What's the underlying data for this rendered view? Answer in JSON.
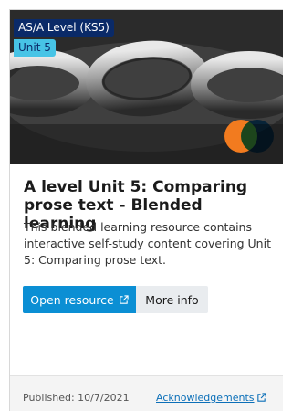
{
  "card": {
    "tags": {
      "level": "AS/A Level (KS5)",
      "unit": "Unit 5"
    },
    "hero_image": "chain-links-photo",
    "logo": "two-circle-logo",
    "title": "A level Unit 5: Comparing prose text - Blended learning",
    "description": "This blended learning resource contains interactive self-study content covering Unit 5: Comparing prose text.",
    "buttons": {
      "open": "Open resource",
      "more": "More info"
    },
    "footer": {
      "published": "Published: 10/7/2021",
      "acknowledgements": "Acknowledgements"
    }
  },
  "colors": {
    "level_tag": "#0a2a68",
    "unit_tag": "#47c4e6",
    "primary_button": "#0b8fd4",
    "secondary_button": "#e9ecef",
    "link": "#0b6fb8",
    "logo_orange": "#f27b1f",
    "logo_blue": "#1e8fe0"
  },
  "icons": {
    "open_external": "external-link-icon",
    "ack_external": "external-link-icon"
  }
}
